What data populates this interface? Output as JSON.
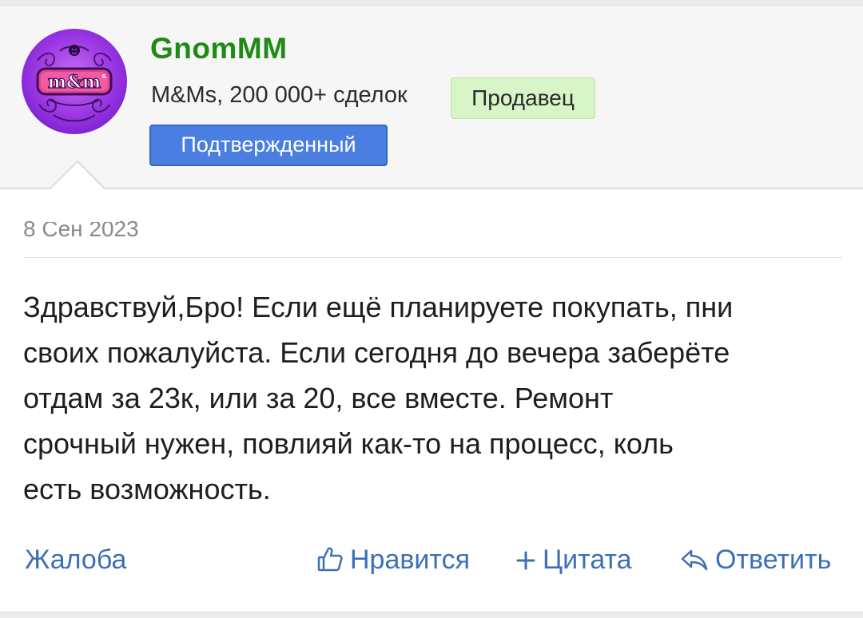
{
  "post": {
    "author": {
      "name": "GnomMM",
      "subtitle": "M&Ms, 200 000+ сделок",
      "badge_seller": "Продавец",
      "badge_confirmed": "Подтвержденный",
      "avatar_icon": "mms-logo-avatar"
    },
    "date": "8 Сен 2023",
    "message_lines": [
      "Здравствуй,Бро! Если ещё планируете покупать, пни",
      "своих пожалуйста. Если сегодня до вечера заберёте",
      "отдам за 23к, или за 20, все вместе. Ремонт",
      "срочный нужен, повлияй как-то на процесс, коль",
      "есть возможность."
    ]
  },
  "actions": {
    "report": "Жалоба",
    "like": "Нравится",
    "quote": "Цитата",
    "reply": "Ответить"
  },
  "colors": {
    "username": "#1f8a14",
    "link": "#3d6fb6",
    "badge_seller_bg": "#d8f5c8",
    "badge_confirmed_bg": "#4a7ee0",
    "header_bg": "#f6f6f6"
  }
}
